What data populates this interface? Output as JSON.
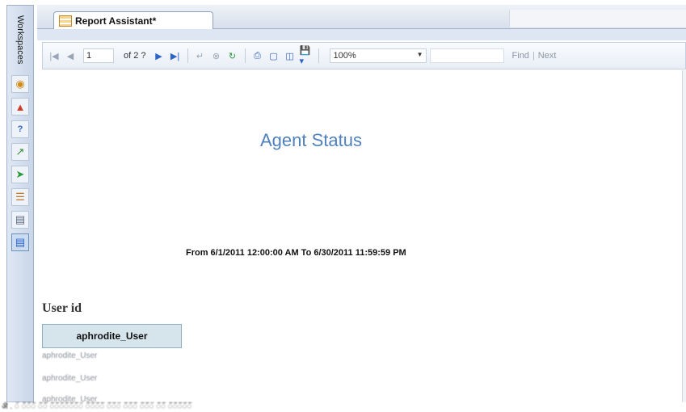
{
  "workspace": {
    "label": "Workspaces",
    "icons": [
      "palette-icon",
      "shapes-icon",
      "question-icon",
      "chart-icon",
      "arrow-icon",
      "list-icon",
      "form-icon",
      "report-icon"
    ]
  },
  "tab": {
    "title": "Report Assistant*"
  },
  "toolbar": {
    "page_current": "1",
    "page_of": "of 2 ?",
    "zoom": "100%",
    "find_label": "Find",
    "separator": "|",
    "next_label": "Next"
  },
  "report": {
    "title": "Agent Status",
    "date_range": "From 6/1/2011 12:00:00 AM  To 6/30/2011 11:59:59 PM",
    "user_id_label": "User id",
    "user_header": "aphrodite_User",
    "user_rows": [
      "aphrodite_User",
      "aphrodite_User",
      "aphrodite_User"
    ]
  },
  "bottom_text": "ऄ . ऀ ऀऀऀऀऀऀ ऀऀऀऀ ऀऀऀऀऀऀऀऀऀऀऀऀऀ ऀऀऀऀऀऀऀऀ ऀऀऀऀऀ ऀऀऀऀऀऀ ऀऀऀऀऀ ऀऀऀऀ ऀऀऀऀऀऀऀऀऀऀ"
}
